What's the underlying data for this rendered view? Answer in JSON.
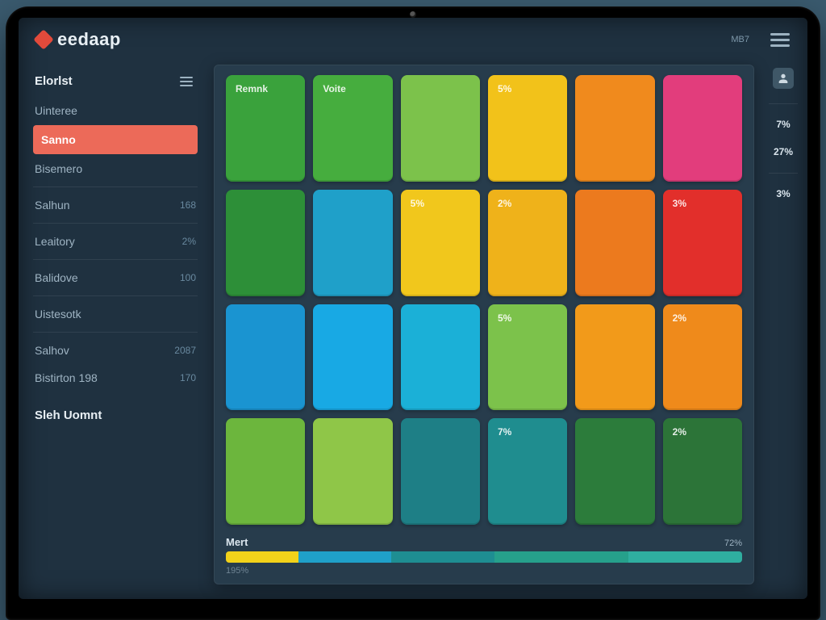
{
  "brand": {
    "name": "eedaap"
  },
  "topbar": {
    "status_label": "",
    "status_value": "MB7"
  },
  "sidebar": {
    "header": "Elorlst",
    "items": [
      {
        "label": "Uinteree",
        "value": ""
      },
      {
        "label": "Sanno",
        "value": "",
        "active": true
      },
      {
        "label": "Bisemero",
        "value": ""
      },
      {
        "label": "Salhun",
        "value": "168"
      },
      {
        "label": "Leaitory",
        "value": "2%"
      },
      {
        "label": "Balidove",
        "value": "100"
      },
      {
        "label": "Uistesotk",
        "value": ""
      },
      {
        "label": "Salhov",
        "value": "2087"
      },
      {
        "label": "Bistirton 198",
        "value": "170"
      }
    ],
    "bottom": "Sleh Uomnt"
  },
  "rightbar": {
    "items": [
      {
        "label": "",
        "value": ""
      },
      {
        "label": "",
        "value": "7%"
      },
      {
        "label": "",
        "value": "27%"
      },
      {
        "label": "",
        "value": ""
      },
      {
        "label": "",
        "value": "3%"
      }
    ]
  },
  "heat": {
    "rows": [
      [
        {
          "color": "#3aa23c",
          "label": "Remnk"
        },
        {
          "color": "#46ad3e",
          "label": "Voite"
        },
        {
          "color": "#7cc24b",
          "label": ""
        },
        {
          "color": "#f2c21a",
          "label": "5%"
        },
        {
          "color": "#f08a1d",
          "label": ""
        },
        {
          "color": "#e23d7c",
          "label": ""
        }
      ],
      [
        {
          "color": "#2d8f38",
          "label": ""
        },
        {
          "color": "#1fa0c9",
          "label": ""
        },
        {
          "color": "#f1c71c",
          "label": "5%"
        },
        {
          "color": "#efb21a",
          "label": "2%"
        },
        {
          "color": "#ec7a1e",
          "label": ""
        },
        {
          "color": "#e22f2b",
          "label": "3%"
        }
      ],
      [
        {
          "color": "#1a94d1",
          "label": ""
        },
        {
          "color": "#18a9e4",
          "label": ""
        },
        {
          "color": "#1bb0d7",
          "label": ""
        },
        {
          "color": "#7cc24b",
          "label": "5%"
        },
        {
          "color": "#f29a1a",
          "label": ""
        },
        {
          "color": "#ef8a1b",
          "label": "2%"
        }
      ],
      [
        {
          "color": "#6cb63d",
          "label": ""
        },
        {
          "color": "#8fc648",
          "label": ""
        },
        {
          "color": "#1e7f86",
          "label": ""
        },
        {
          "color": "#1f8d8f",
          "label": "7%"
        },
        {
          "color": "#2c7c3b",
          "label": ""
        },
        {
          "color": "#2c7438",
          "label": "2%"
        }
      ]
    ]
  },
  "bar": {
    "title": "Mert",
    "left_label": "195%",
    "right_label": "72%",
    "segments": [
      {
        "color": "#f2d21a",
        "pct": 14
      },
      {
        "color": "#1fa0c9",
        "pct": 18
      },
      {
        "color": "#1e8e92",
        "pct": 20
      },
      {
        "color": "#26a08b",
        "pct": 26
      },
      {
        "color": "#2faea0",
        "pct": 22
      }
    ]
  },
  "colors": {
    "bg": "#1f3140",
    "panel": "#273c4c",
    "accent": "#ec6a59"
  }
}
